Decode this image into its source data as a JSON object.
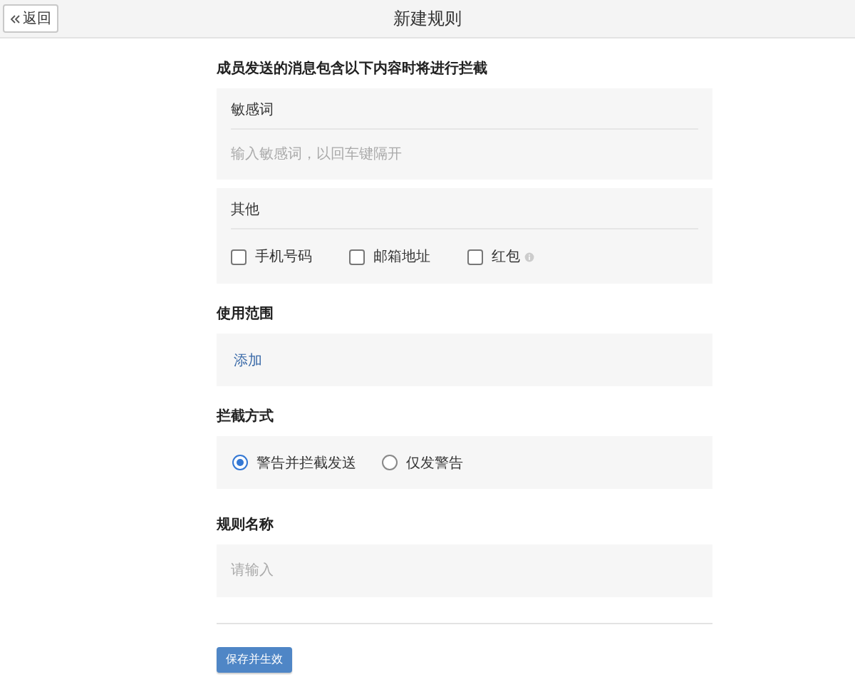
{
  "header": {
    "back_button": "返回",
    "title": "新建规则"
  },
  "intro": "成员发送的消息包含以下内容时将进行拦截",
  "sensitive_words": {
    "label": "敏感词",
    "placeholder": "输入敏感词，以回车键隔开"
  },
  "other": {
    "label": "其他",
    "options": [
      {
        "label": "手机号码",
        "checked": false,
        "info": false
      },
      {
        "label": "邮箱地址",
        "checked": false,
        "info": false
      },
      {
        "label": "红包",
        "checked": false,
        "info": true
      }
    ]
  },
  "scope": {
    "label": "使用范围",
    "add_link": "添加"
  },
  "mode": {
    "label": "拦截方式",
    "options": [
      {
        "label": "警告并拦截发送",
        "selected": true
      },
      {
        "label": "仅发警告",
        "selected": false
      }
    ]
  },
  "rule_name": {
    "label": "规则名称",
    "placeholder": "请输入"
  },
  "save_button": "保存并生效"
}
